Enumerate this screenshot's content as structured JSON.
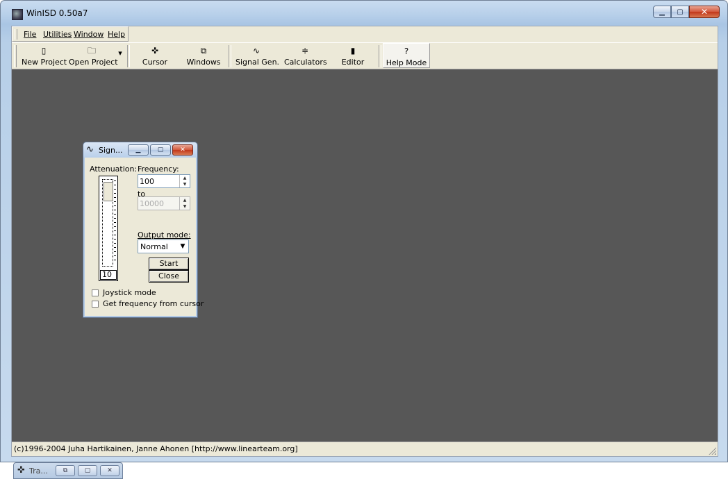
{
  "window": {
    "title": "WinISD 0.50a7",
    "caption_minimize": "▁",
    "caption_maximize": "▢",
    "caption_close": "✕"
  },
  "menu": {
    "file": "File",
    "utilities": "Utilities",
    "window": "Window",
    "help": "Help"
  },
  "toolbar": {
    "new_project": "New Project",
    "open_project": "Open Project",
    "cursor": "Cursor",
    "windows": "Windows",
    "signal_gen": "Signal Gen.",
    "calculators": "Calculators",
    "editor": "Editor",
    "help_mode": "Help Mode",
    "dropdown_arrow": "▾",
    "help_icon": "?"
  },
  "signal_window": {
    "title": "Sign...",
    "title_icon": "∿",
    "attenuation_label": "Attenuation:",
    "attenuation_value": "10",
    "frequency_label": "Frequency:",
    "frequency_value": "100",
    "to_label": "to",
    "to_value": "10000",
    "output_mode_label": "Output mode:",
    "output_mode_value": "Normal",
    "start_button": "Start",
    "close_button": "Close",
    "joystick_mode": "Joystick mode",
    "get_frequency": "Get frequency from cursor"
  },
  "minimized_window": {
    "title": "Tra..."
  },
  "status": {
    "text": "(c)1996-2004 Juha Hartikainen, Janne Ahonen [http://www.linearteam.org]"
  },
  "icons": [
    "app-icon",
    "new-project-icon",
    "open-project-icon",
    "cursor-icon",
    "windows-icon",
    "signal-gen-icon",
    "calculators-icon",
    "editor-icon",
    "help-icon"
  ]
}
